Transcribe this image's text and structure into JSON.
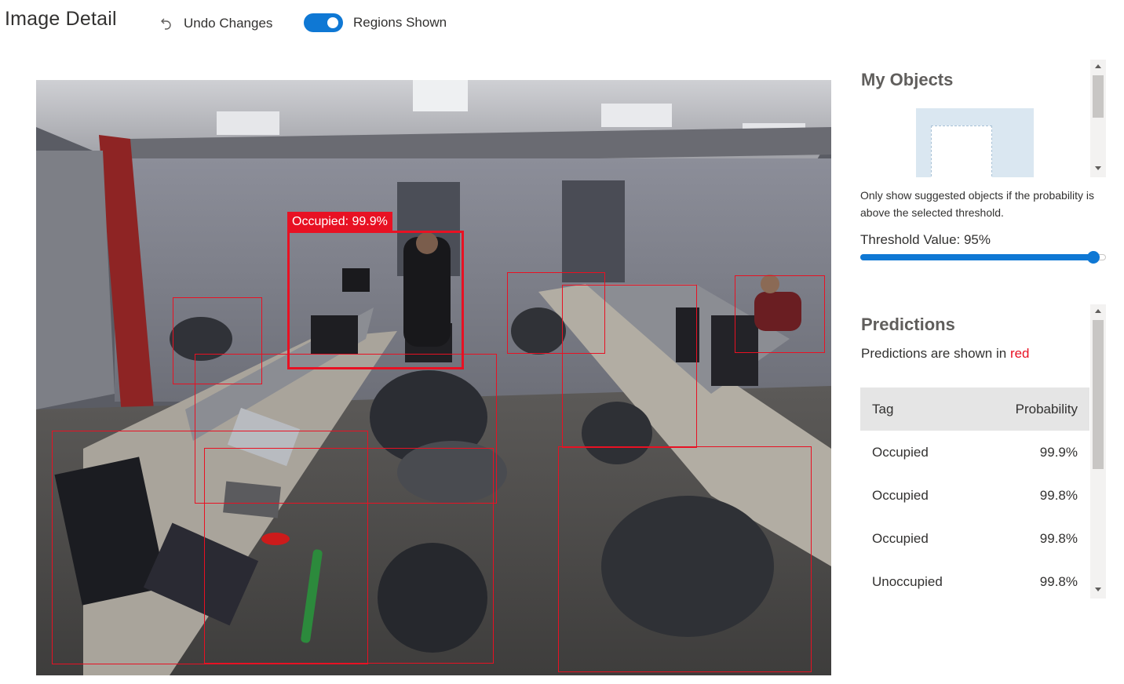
{
  "header": {
    "title": "Image Detail",
    "undo_label": "Undo Changes",
    "regions_toggle_label": "Regions Shown",
    "regions_shown": true
  },
  "image": {
    "selected_region_label": "Occupied: 99.9%",
    "region_color": "#e81123"
  },
  "my_objects": {
    "title": "My Objects",
    "threshold_note": "Only show suggested objects if the probability is above the selected threshold.",
    "threshold_label": "Threshold Value: 95%",
    "threshold_value": 95
  },
  "predictions": {
    "title": "Predictions",
    "note_prefix": "Predictions are shown in ",
    "note_color_word": "red",
    "columns": {
      "tag": "Tag",
      "probability": "Probability"
    },
    "rows": [
      {
        "tag": "Occupied",
        "probability": "99.9%"
      },
      {
        "tag": "Occupied",
        "probability": "99.8%"
      },
      {
        "tag": "Occupied",
        "probability": "99.8%"
      },
      {
        "tag": "Unoccupied",
        "probability": "99.8%"
      }
    ]
  },
  "colors": {
    "accent": "#0f78d4",
    "prediction_red": "#e81123",
    "table_header_bg": "#e5e5e5"
  }
}
